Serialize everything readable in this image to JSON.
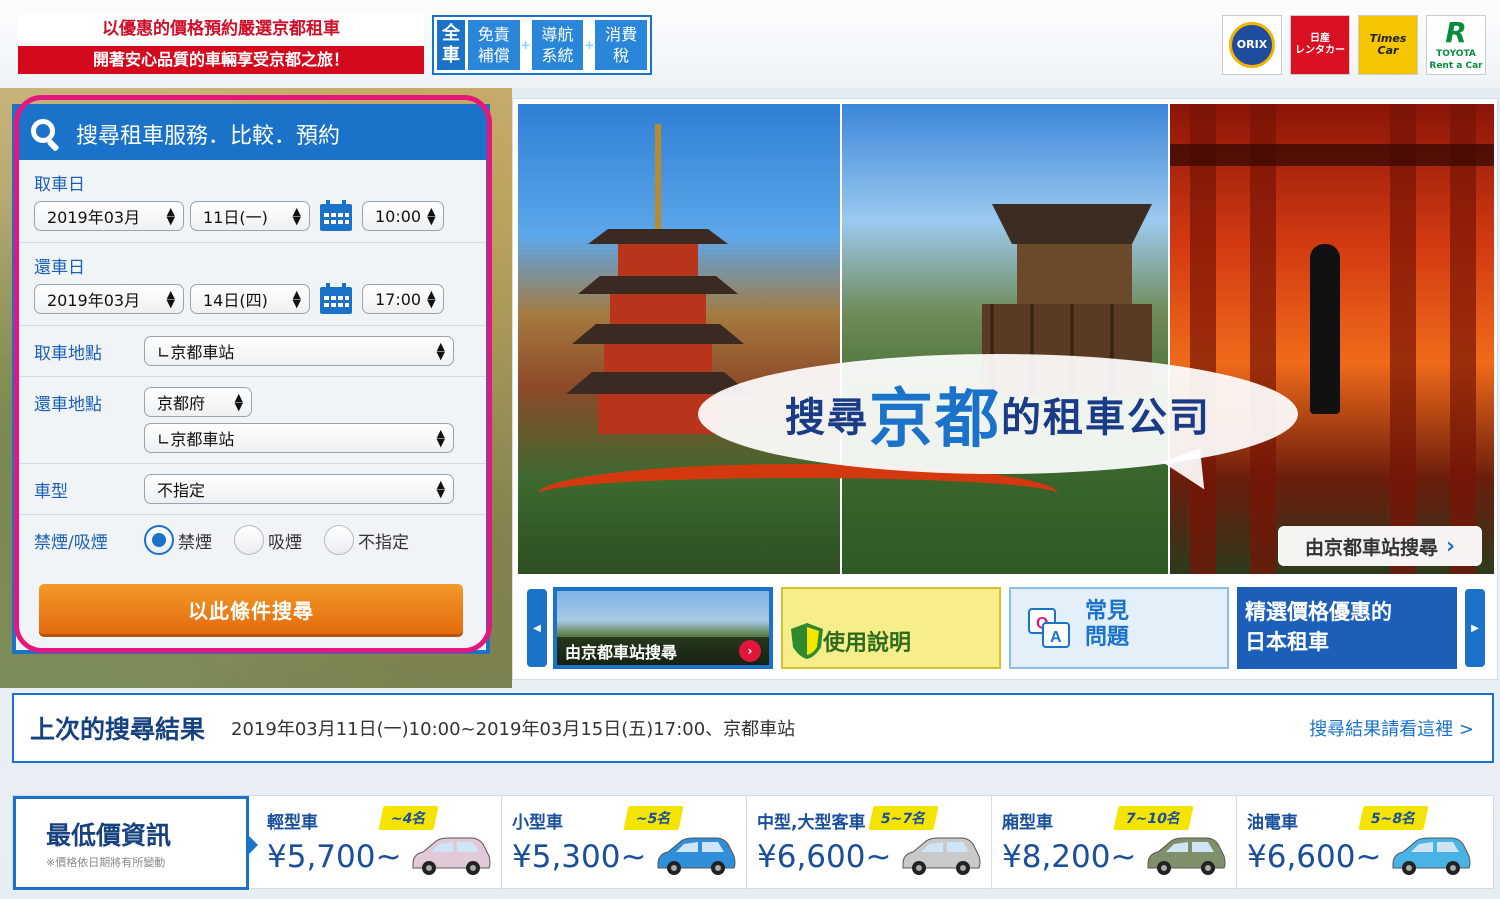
{
  "header": {
    "promo_top": "以優惠的價格預約嚴選京都租車",
    "promo_bottom": "開著安心品質的車輛享受京都之旅！",
    "feature_all": [
      "全",
      "車"
    ],
    "features": [
      "免責\n補償",
      "導航\n系統",
      "消費\n稅"
    ],
    "logos": [
      {
        "name": "orix-logo",
        "text": "ORIX"
      },
      {
        "name": "nissan-logo",
        "text": "日産\nレンタカー"
      },
      {
        "name": "times-logo",
        "text": "Times\nCar"
      },
      {
        "name": "toyota-logo",
        "text": "TOYOTA\nRent a Car"
      }
    ]
  },
  "search": {
    "title": "搜尋租車服務．比較．預約",
    "pickup_date_label": "取車日",
    "pickup_month": "2019年03月",
    "pickup_day": "11日(一)",
    "pickup_time": "10:00",
    "return_date_label": "還車日",
    "return_month": "2019年03月",
    "return_day": "14日(四)",
    "return_time": "17:00",
    "pickup_place_label": "取車地點",
    "pickup_place": "∟京都車站",
    "return_place_label": "還車地點",
    "return_pref": "京都府",
    "return_place": "∟京都車站",
    "car_type_label": "車型",
    "car_type": "不指定",
    "smoking_label": "禁煙/吸煙",
    "smoking_options": [
      "禁煙",
      "吸煙",
      "不指定"
    ],
    "smoking_selected": "禁煙",
    "submit": "以此條件搜尋"
  },
  "hero": {
    "bubble_pre": "搜尋",
    "bubble_big": "京都",
    "bubble_post": "的租車公司",
    "link": "由京都車站搜尋",
    "thumbs": [
      {
        "label": "由京都車站搜尋"
      },
      {
        "label": "使用說明"
      },
      {
        "label": "常見\n問題"
      },
      {
        "label": "精選價格優惠的\n日本租車"
      }
    ]
  },
  "last_search": {
    "title": "上次的搜尋結果",
    "text": "2019年03月11日(一)10:00~2019年03月15日(五)17:00、京都車站",
    "link": "搜尋結果請看這裡 >"
  },
  "lowest_price": {
    "title": "最低價資訊",
    "note": "※價格依日期將有所變動",
    "items": [
      {
        "type": "輕型車",
        "capacity": "~4名",
        "price": "¥5,700~",
        "color": "#e2c9d8"
      },
      {
        "type": "小型車",
        "capacity": "~5名",
        "price": "¥5,300~",
        "color": "#2f8fd8"
      },
      {
        "type": "中型,大型客車",
        "capacity": "5~7名",
        "price": "¥6,600~",
        "color": "#c9c9c9"
      },
      {
        "type": "廂型車",
        "capacity": "7~10名",
        "price": "¥8,200~",
        "color": "#7f8f6a"
      },
      {
        "type": "油電車",
        "capacity": "5~8名",
        "price": "¥6,600~",
        "color": "#4ab3e6"
      }
    ]
  },
  "colors": {
    "accent": "#1a73c8",
    "highlight_ring": "#e4177c",
    "button": "#e97812"
  }
}
